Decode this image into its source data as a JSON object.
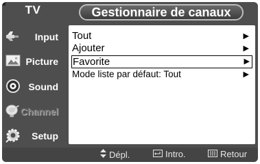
{
  "header": {
    "source_label": "TV",
    "title": "Gestionnaire de canaux"
  },
  "sidebar": {
    "items": [
      {
        "label": "Input",
        "icon": "input-plug-icon",
        "state": "normal"
      },
      {
        "label": "Picture",
        "icon": "picture-icon",
        "state": "normal"
      },
      {
        "label": "Sound",
        "icon": "speaker-icon",
        "state": "normal"
      },
      {
        "label": "Channel",
        "icon": "satellite-dish-icon",
        "state": "active"
      },
      {
        "label": "Setup",
        "icon": "setup-gear-icon",
        "state": "normal"
      }
    ]
  },
  "menu": {
    "items": [
      {
        "label": "Tout",
        "has_submenu": true,
        "selected": false
      },
      {
        "label": "Ajouter",
        "has_submenu": true,
        "selected": false
      },
      {
        "label": "Favorite",
        "has_submenu": true,
        "selected": true
      },
      {
        "label": "Mode liste par défaut: Tout",
        "has_submenu": true,
        "selected": false
      }
    ]
  },
  "footer": {
    "move_label": "Dépl.",
    "enter_label": "Intro.",
    "return_label": "Retour"
  },
  "colors": {
    "frame": "#4e4e4e",
    "panel": "#ffffff",
    "text": "#000000",
    "sidebar_text": "#ffffff",
    "footer_text": "#e6e6e6"
  }
}
